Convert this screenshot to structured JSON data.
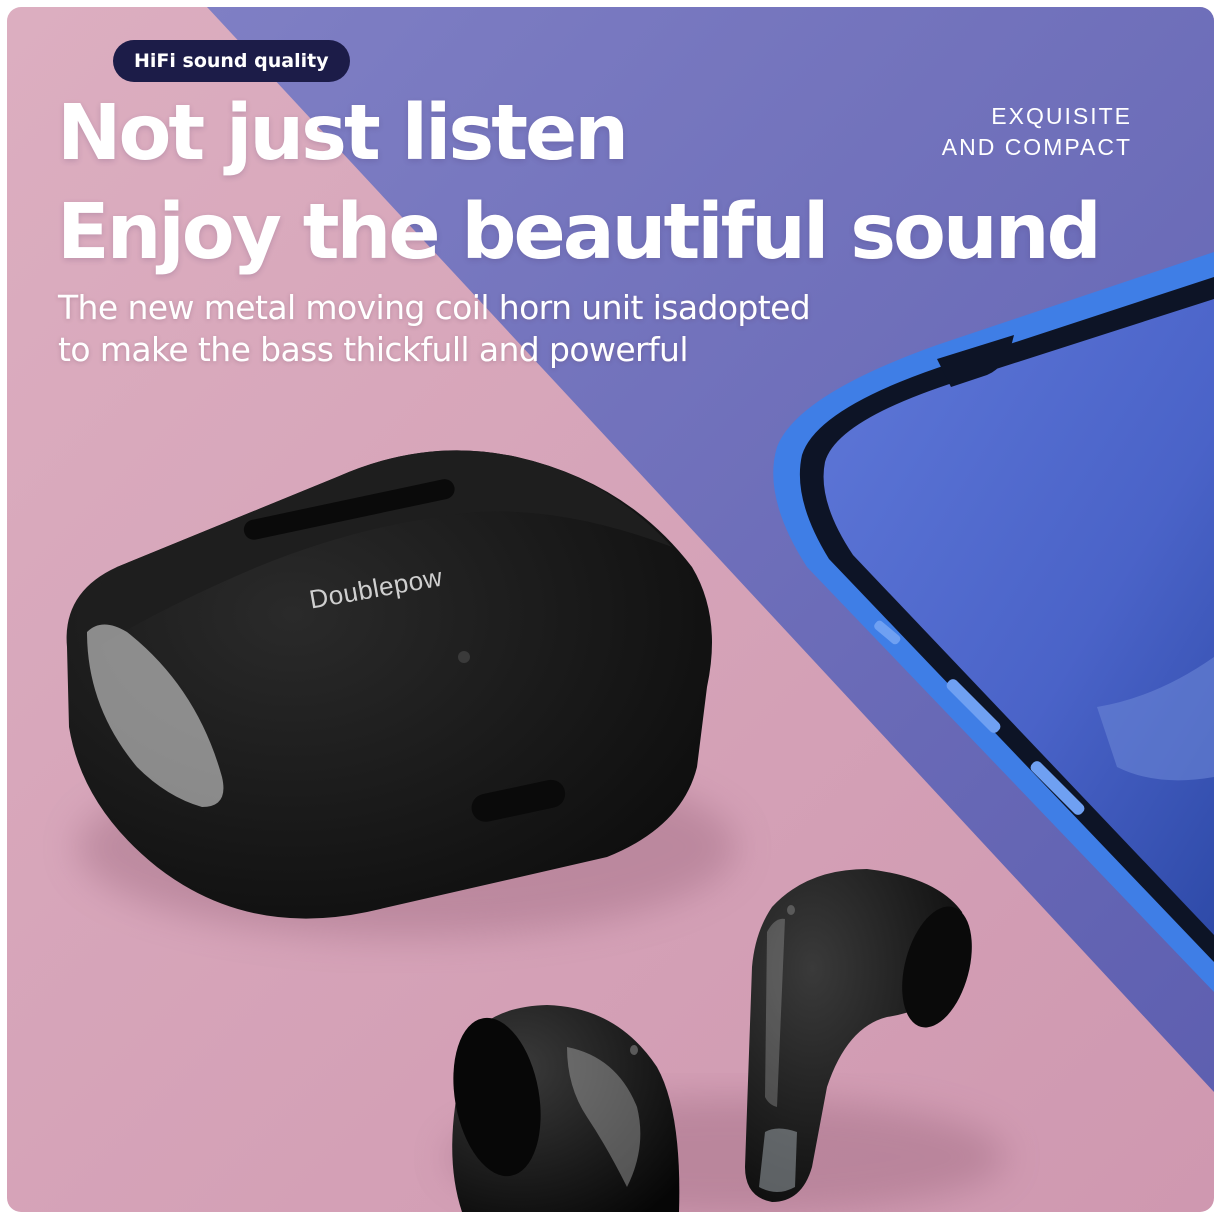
{
  "badge": {
    "label": "HiFi sound quality"
  },
  "headline": {
    "line1": "Not just listen",
    "line2": "Enjoy the beautiful sound"
  },
  "subtitle": {
    "line1": "The new metal moving coil horn unit isadopted",
    "line2": "to make the bass thickfull and powerful"
  },
  "tagline": {
    "line1": "EXQUISITE",
    "line2": "AND COMPACT"
  },
  "product": {
    "logo_text": "Doublepow"
  },
  "colors": {
    "pink_background": "#d9a6bc",
    "purple_background": "#6f6fb8",
    "badge_background": "#1c1c48",
    "phone_blue": "#3a78e0",
    "case_black": "#141414"
  }
}
